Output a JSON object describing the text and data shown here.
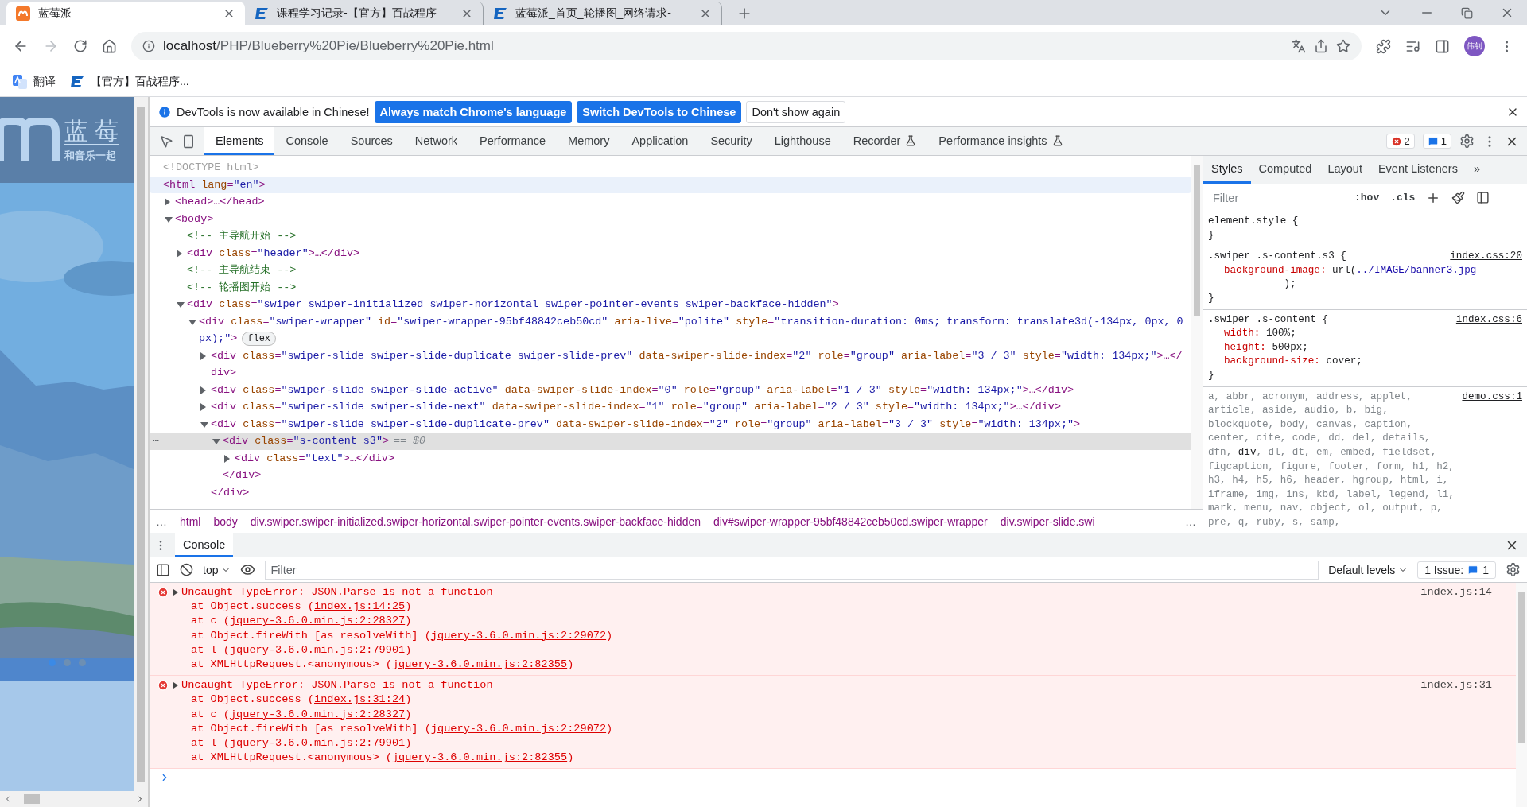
{
  "browser": {
    "tabs": [
      {
        "title": "蓝莓派",
        "kind": "berry",
        "selected": true
      },
      {
        "title": "课程学习记录-【官方】百战程序",
        "kind": "school",
        "selected": false
      },
      {
        "title": "蓝莓派_首页_轮播图_网络请求-",
        "kind": "school",
        "selected": false
      }
    ],
    "address": {
      "host": "localhost",
      "path": "/PHP/Blueberry%20Pie/Blueberry%20Pie.html"
    },
    "profile": "伟钊",
    "bookmarks": [
      {
        "title": "翻译",
        "kind": "translate"
      },
      {
        "title": "【官方】百战程序...",
        "kind": "school"
      }
    ]
  },
  "page": {
    "logo_title": "蓝 莓",
    "logo_slogan": "和音乐一起",
    "slides": [
      {
        "selected": true
      },
      {
        "selected": false
      },
      {
        "selected": false
      }
    ]
  },
  "devtools": {
    "infobar": {
      "message": "DevTools is now available in Chinese!",
      "buttons": [
        {
          "label": "Always match Chrome's language",
          "primary": true
        },
        {
          "label": "Switch DevTools to Chinese",
          "primary": true
        },
        {
          "label": "Don't show again",
          "primary": false
        }
      ]
    },
    "tabs": [
      {
        "label": "Elements",
        "selected": true,
        "experimental": false
      },
      {
        "label": "Console",
        "selected": false,
        "experimental": false
      },
      {
        "label": "Sources",
        "selected": false,
        "experimental": false
      },
      {
        "label": "Network",
        "selected": false,
        "experimental": false
      },
      {
        "label": "Performance",
        "selected": false,
        "experimental": false
      },
      {
        "label": "Memory",
        "selected": false,
        "experimental": false
      },
      {
        "label": "Application",
        "selected": false,
        "experimental": false
      },
      {
        "label": "Security",
        "selected": false,
        "experimental": false
      },
      {
        "label": "Lighthouse",
        "selected": false,
        "experimental": false
      },
      {
        "label": "Recorder",
        "selected": false,
        "experimental": true
      },
      {
        "label": "Performance insights",
        "selected": false,
        "experimental": true
      }
    ],
    "error_count": "2",
    "issue_count": "1",
    "elements": {
      "nodes": [
        {
          "kind": "doctype",
          "text": "<!DOCTYPE html>"
        },
        {
          "kind": "element",
          "text": "<html lang=\"en\">",
          "hovered": true,
          "children": [
            {
              "kind": "element",
              "text": "<head>…</head>",
              "expanded": false
            },
            {
              "kind": "element",
              "text": "<body>",
              "expanded": true,
              "children": [
                {
                  "kind": "comment",
                  "text": "<!-- 主导航开始 -->"
                },
                {
                  "kind": "element",
                  "text": "<div class=\"header\">…</div>",
                  "expanded": false
                },
                {
                  "kind": "comment",
                  "text": "<!-- 主导航结束 -->"
                },
                {
                  "kind": "comment",
                  "text": "<!-- 轮播图开始 -->"
                },
                {
                  "kind": "element",
                  "text": "<div class=\"swiper swiper-initialized swiper-horizontal swiper-pointer-events swiper-backface-hidden\">",
                  "expanded": true,
                  "children": [
                    {
                      "kind": "element",
                      "text": "<div class=\"swiper-wrapper\" id=\"swiper-wrapper-95bf48842ceb50cd\" aria-live=\"polite\" style=\"transition-duration: 0ms; transform: translate3d(-134px, 0px, 0px);\">",
                      "badge": "flex",
                      "expanded": true,
                      "children": [
                        {
                          "kind": "element",
                          "text": "<div class=\"swiper-slide swiper-slide-duplicate swiper-slide-prev\" data-swiper-slide-index=\"2\" role=\"group\" aria-label=\"3 / 3\" style=\"width: 134px;\">…</div>",
                          "expanded": false
                        },
                        {
                          "kind": "element",
                          "text": "<div class=\"swiper-slide swiper-slide-active\" data-swiper-slide-index=\"0\" role=\"group\" aria-label=\"1 / 3\" style=\"width: 134px;\">…</div>",
                          "expanded": false
                        },
                        {
                          "kind": "element",
                          "text": "<div class=\"swiper-slide swiper-slide-next\" data-swiper-slide-index=\"1\" role=\"group\" aria-label=\"2 / 3\" style=\"width: 134px;\">…</div>",
                          "expanded": false
                        },
                        {
                          "kind": "element",
                          "text": "<div class=\"swiper-slide swiper-slide-duplicate-prev\" data-swiper-slide-index=\"2\" role=\"group\" aria-label=\"3 / 3\" style=\"width: 134px;\">",
                          "expanded": true,
                          "close": "</div>",
                          "children": [
                            {
                              "kind": "element",
                              "text": "<div class=\"s-content s3\">",
                              "selected": true,
                              "gutter": "⋯",
                              "ref": "== $0",
                              "expanded": true,
                              "close": "</div>",
                              "children": [
                                {
                                  "kind": "element",
                                  "text": "<div class=\"text\">…</div>",
                                  "expanded": false
                                }
                              ]
                            }
                          ]
                        }
                      ]
                    }
                  ]
                }
              ]
            }
          ]
        }
      ]
    },
    "breadcrumbs": {
      "overflow_left": "…",
      "items": [
        "html",
        "body",
        "div.swiper.swiper-initialized.swiper-horizontal.swiper-pointer-events.swiper-backface-hidden",
        "div#swiper-wrapper-95bf48842ceb50cd.swiper-wrapper",
        "div.swiper-slide.swi"
      ],
      "overflow_right": "…"
    },
    "styles": {
      "tabs": [
        {
          "label": "Styles",
          "selected": true
        },
        {
          "label": "Computed",
          "selected": false
        },
        {
          "label": "Layout",
          "selected": false
        },
        {
          "label": "Event Listeners",
          "selected": false
        }
      ],
      "more": "»",
      "filter_placeholder": "Filter",
      "hov": ":hov",
      "cls": ".cls",
      "rules": [
        {
          "selector": "element.style {",
          "close": "}"
        },
        {
          "selector": ".swiper .s-content.s3 {",
          "source": "index.css:20",
          "close": "}",
          "declarations": [
            {
              "name": "background-image:",
              "value": "url(",
              "link": "../IMAGE/banner3.jpg",
              "after": ");"
            }
          ]
        },
        {
          "selector": ".swiper .s-content {",
          "source": "index.css:6",
          "close": "}",
          "declarations": [
            {
              "name": "width:",
              "value": "100%;"
            },
            {
              "name": "height:",
              "value": "500px;"
            },
            {
              "name": "background-size:",
              "value": "cover;"
            }
          ]
        },
        {
          "source": "demo.css:1",
          "selector_parts": [
            {
              "text": "a, abbr, acronym, address, applet, article, aside, audio, b, big, blockquote, body, canvas, caption, center, cite, code, dd, del, details, dfn, ",
              "matched": false
            },
            {
              "text": "div",
              "matched": true
            },
            {
              "text": ", dl, dt, em, embed, fieldset, figcaption, figure, footer, form, h1, h2, h3, h4, h5, h6, header, hgroup, html, i, iframe, img, ins, kbd, label, legend, li, mark, menu, nav, object, ol, output, p, pre, q, ruby, s, samp,",
              "matched": false
            }
          ]
        }
      ]
    },
    "drawer": {
      "tab": "Console",
      "context": "top",
      "filter_placeholder": "Filter",
      "levels": "Default levels",
      "issues_label": "1 Issue:",
      "issues_count": "1",
      "messages": [
        {
          "text": "Uncaught TypeError: JSON.Parse is not a function",
          "source": "index.js:14",
          "expanded": false,
          "stack": [
            {
              "before": "at Object.success (",
              "link": "index.js:14:25",
              "after": ")"
            },
            {
              "before": "at c (",
              "link": "jquery-3.6.0.min.js:2:28327",
              "after": ")"
            },
            {
              "before": "at Object.fireWith [as resolveWith] (",
              "link": "jquery-3.6.0.min.js:2:29072",
              "after": ")"
            },
            {
              "before": "at l (",
              "link": "jquery-3.6.0.min.js:2:79901",
              "after": ")"
            },
            {
              "before": "at XMLHttpRequest.<anonymous> (",
              "link": "jquery-3.6.0.min.js:2:82355",
              "after": ")"
            }
          ]
        },
        {
          "text": "Uncaught TypeError: JSON.Parse is not a function",
          "source": "index.js:31",
          "expanded": false,
          "stack": [
            {
              "before": "at Object.success (",
              "link": "index.js:31:24",
              "after": ")"
            },
            {
              "before": "at c (",
              "link": "jquery-3.6.0.min.js:2:28327",
              "after": ")"
            },
            {
              "before": "at Object.fireWith [as resolveWith] (",
              "link": "jquery-3.6.0.min.js:2:29072",
              "after": ")"
            },
            {
              "before": "at l (",
              "link": "jquery-3.6.0.min.js:2:79901",
              "after": ")"
            },
            {
              "before": "at XMLHttpRequest.<anonymous> (",
              "link": "jquery-3.6.0.min.js:2:82355",
              "after": ")"
            }
          ]
        }
      ]
    }
  }
}
